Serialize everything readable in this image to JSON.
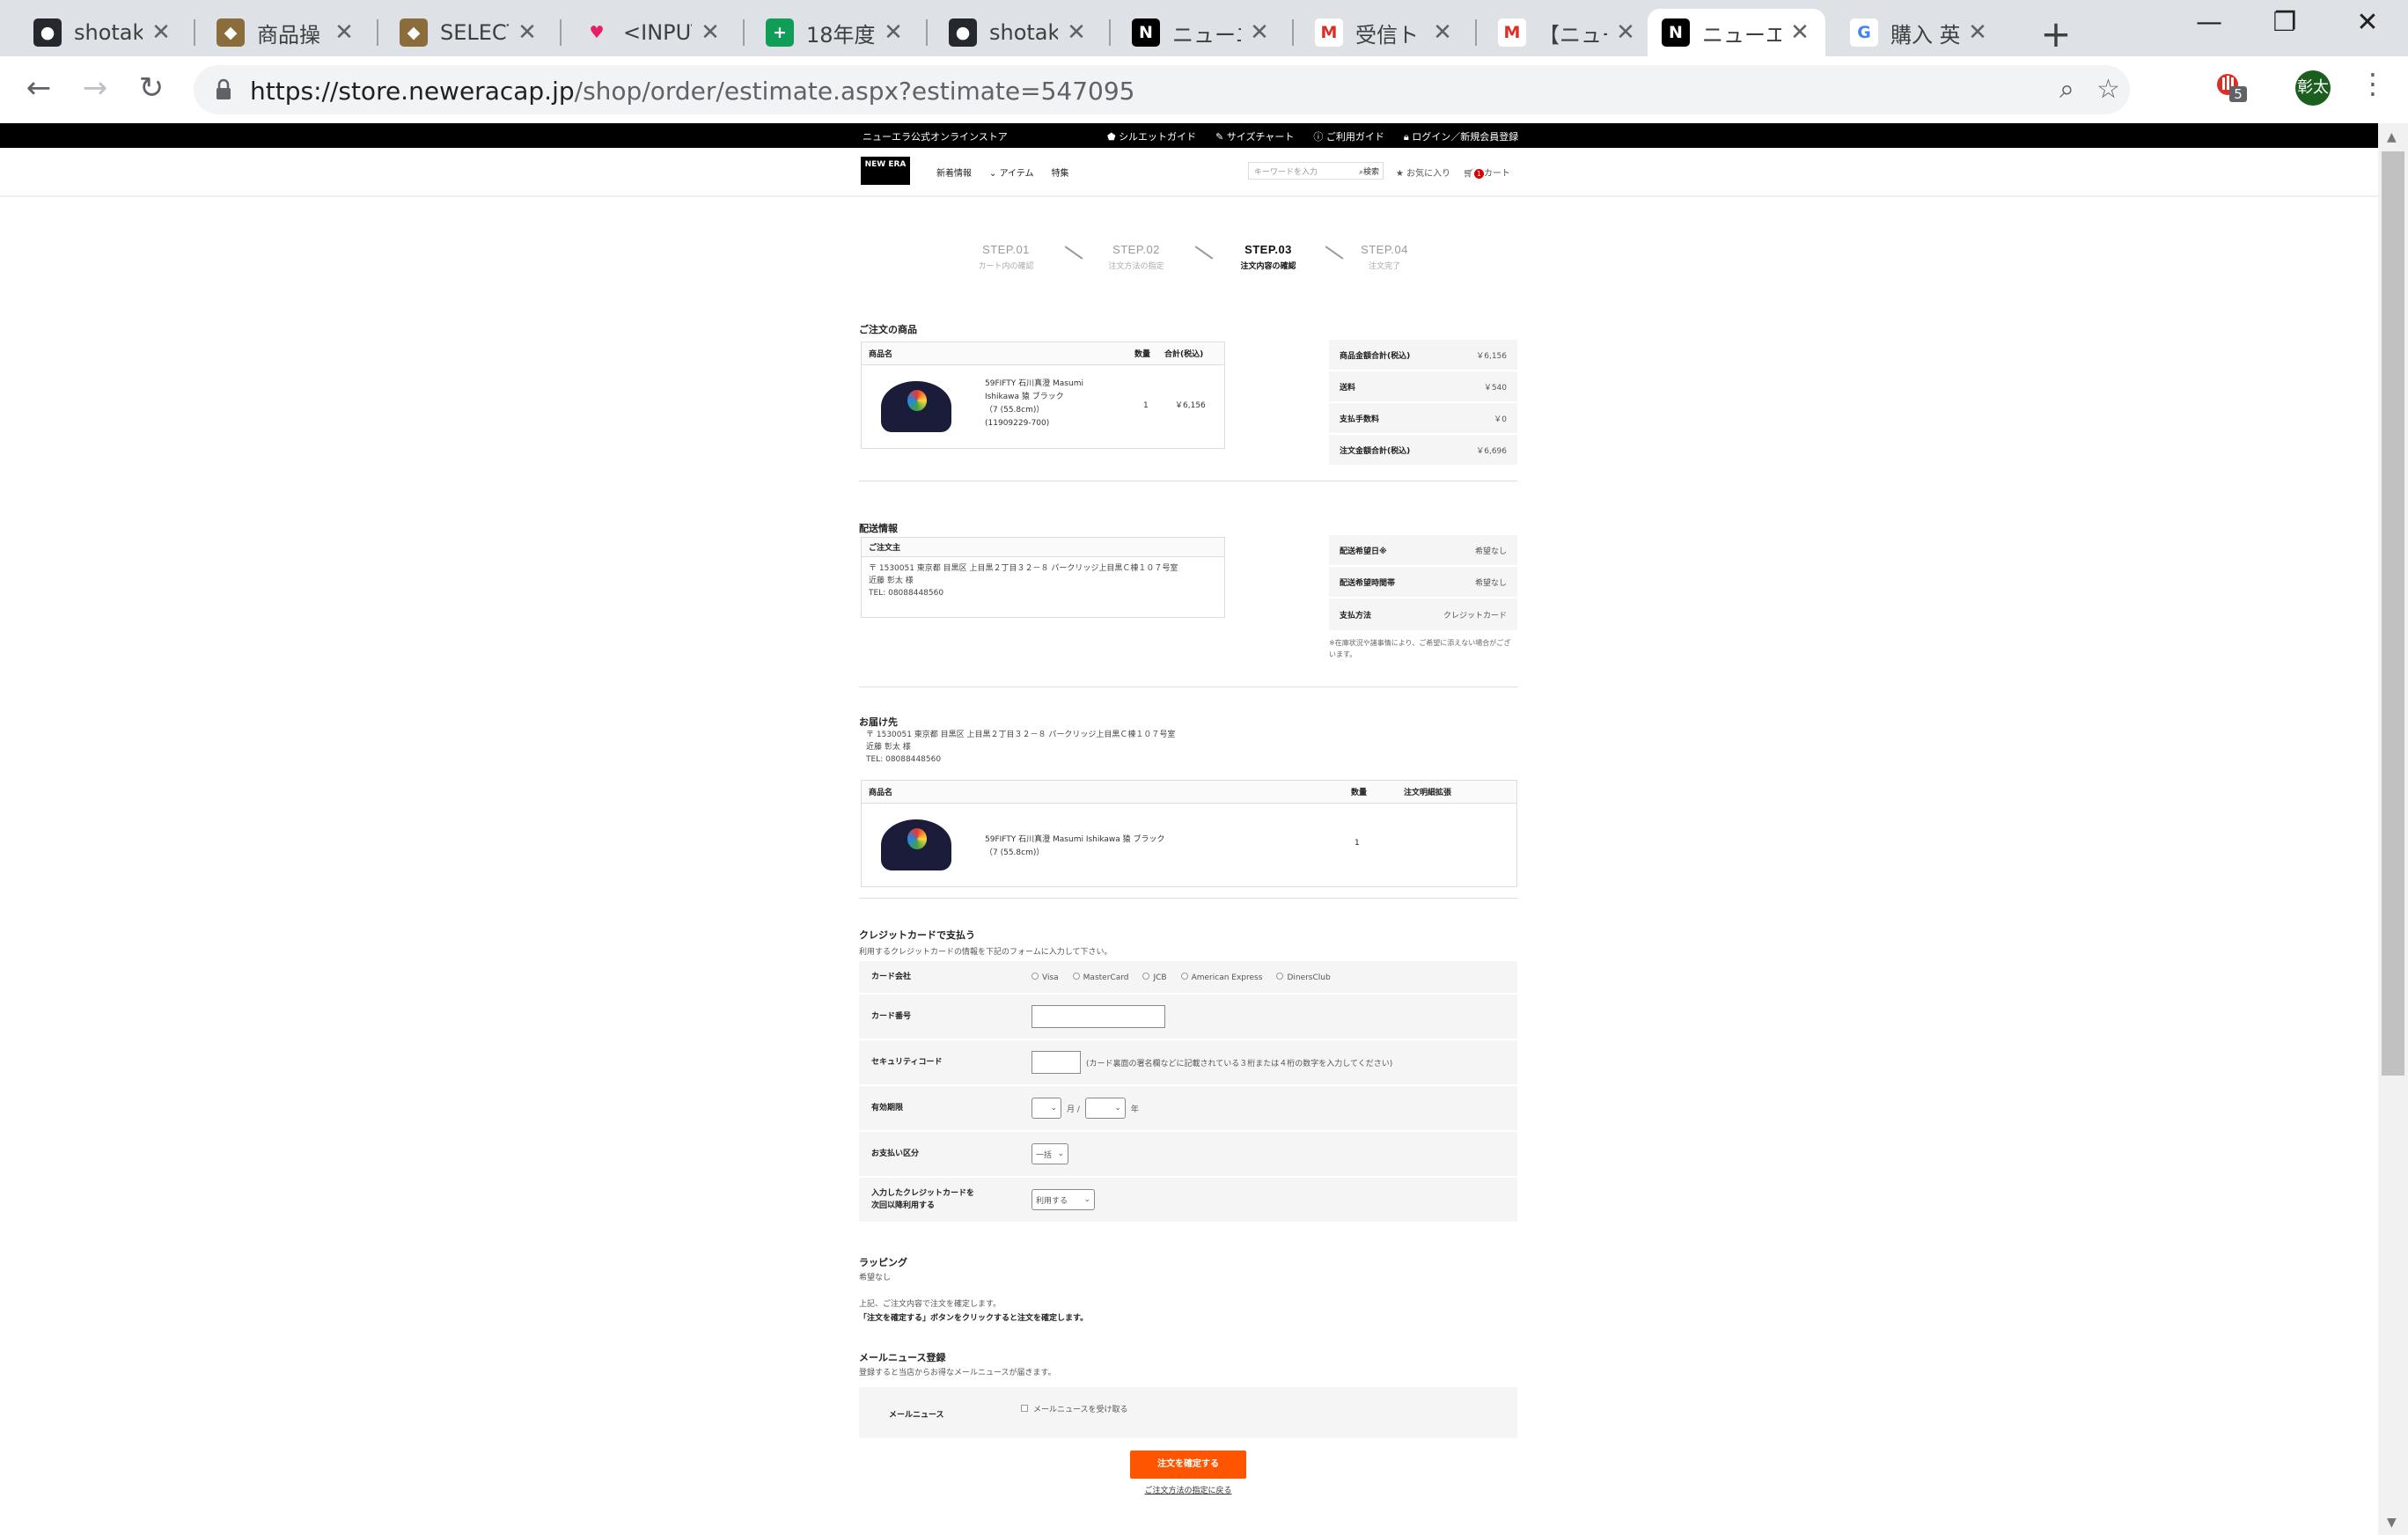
{
  "browser": {
    "tabs": [
      {
        "label": "shotakc",
        "icon": "github"
      },
      {
        "label": "商品操",
        "icon": "app"
      },
      {
        "label": "SELECT",
        "icon": "app"
      },
      {
        "label": "<INPUT",
        "icon": "heart"
      },
      {
        "label": "18年度",
        "icon": "sheets"
      },
      {
        "label": "shotakc",
        "icon": "github"
      },
      {
        "label": "ニューエ",
        "icon": "newera"
      },
      {
        "label": "受信ト",
        "icon": "gmail"
      },
      {
        "label": "【ニューエ",
        "icon": "gmail"
      },
      {
        "label": "ニューエ",
        "icon": "newera"
      },
      {
        "label": "購入 英",
        "icon": "google"
      }
    ],
    "url_host": "https://store.neweracap.jp",
    "url_path": "/shop/order/estimate.aspx?estimate=547095",
    "extension_badge": "5",
    "avatar_label": "彰太"
  },
  "site": {
    "topbar_left": "ニューエラ公式オンラインストア",
    "topbar_links": [
      "シルエットガイド",
      "サイズチャート",
      "ご利用ガイド",
      "ログイン／新規会員登録"
    ],
    "logo": "NEW ERA",
    "nav": [
      "新着情報",
      "アイテム",
      "特集"
    ],
    "search_placeholder": "キーワードを入力",
    "search_button": "検索",
    "favorites": "お気に入り",
    "cart": "カート",
    "cart_count": "1"
  },
  "steps": [
    {
      "num": "STEP.01",
      "label": "カート内の確認"
    },
    {
      "num": "STEP.02",
      "label": "注文方法の指定"
    },
    {
      "num": "STEP.03",
      "label": "注文内容の確認"
    },
    {
      "num": "STEP.04",
      "label": "注文完了"
    }
  ],
  "order": {
    "title": "ご注文の商品",
    "headers": [
      "商品名",
      "数量",
      "合計(税込)"
    ],
    "item_name": "59FIFTY 石川真澄 Masumi Ishikawa 猿 ブラック",
    "item_size": "（7 (55.8cm)）",
    "item_code": "(11909229-700)",
    "qty": "1",
    "total": "￥6,156"
  },
  "summary": [
    {
      "k": "商品金額合計(税込)",
      "v": "￥6,156"
    },
    {
      "k": "送料",
      "v": "￥540"
    },
    {
      "k": "支払手数料",
      "v": "￥0"
    },
    {
      "k": "注文金額合計(税込)",
      "v": "￥6,696"
    }
  ],
  "delivery": {
    "title": "配送情報",
    "orderer_label": "ご注文主",
    "orderer_address": "〒 1530051 東京都 目黒区 上目黒２丁目３２－８ パークリッジ上目黒Ｃ棟１０７号室",
    "orderer_name": "近藤 彰太 様",
    "orderer_tel": "TEL: 08088448560",
    "rows": [
      {
        "k": "配送希望日※",
        "v": "希望なし"
      },
      {
        "k": "配送希望時間帯",
        "v": "希望なし"
      },
      {
        "k": "支払方法",
        "v": "クレジットカード"
      }
    ],
    "note": "※在庫状況や諸事情により、ご希望に添えない場合がございます。"
  },
  "shipto": {
    "title": "お届け先",
    "address": "〒 1530051 東京都 目黒区 上目黒２丁目３２－８ パークリッジ上目黒Ｃ棟１０７号室",
    "name": "近藤 彰太 様",
    "tel": "TEL: 08088448560",
    "headers": [
      "商品名",
      "数量",
      "注文明細拡張"
    ],
    "item_name": "59FIFTY 石川真澄 Masumi Ishikawa 猿 ブラック",
    "item_size": "（7 (55.8cm)）",
    "qty": "1"
  },
  "credit": {
    "title": "クレジットカードで支払う",
    "desc": "利用するクレジットカードの情報を下記のフォームに入力して下さい。",
    "labels": {
      "company": "カード会社",
      "number": "カード番号",
      "security": "セキュリティコード",
      "expiry": "有効期限",
      "installment": "お支払い区分",
      "reuse": "入力したクレジットカードを次回以降利用する"
    },
    "companies": [
      "Visa",
      "MasterCard",
      "JCB",
      "American Express",
      "DinersClub"
    ],
    "security_note": "(カード裏面の署名欄などに記載されている３桁または４桁の数字を入力してください)",
    "month_suffix": "月 /",
    "year_suffix": "年",
    "installment_value": "一括",
    "reuse_value": "利用する"
  },
  "wrapping": {
    "title": "ラッピング",
    "value": "希望なし"
  },
  "confirm_text": {
    "line1": "上記、ご注文内容で注文を確定します。",
    "line2": "「注文を確定する」ボタンをクリックすると注文を確定します。"
  },
  "mailnews": {
    "title": "メールニュース登録",
    "desc": "登録すると当店からお得なメールニュースが届きます。",
    "label": "メールニュース",
    "checkbox": "メールニュースを受け取る"
  },
  "buttons": {
    "confirm": "注文を確定する",
    "back": "ご注文方法の指定に戻る"
  }
}
